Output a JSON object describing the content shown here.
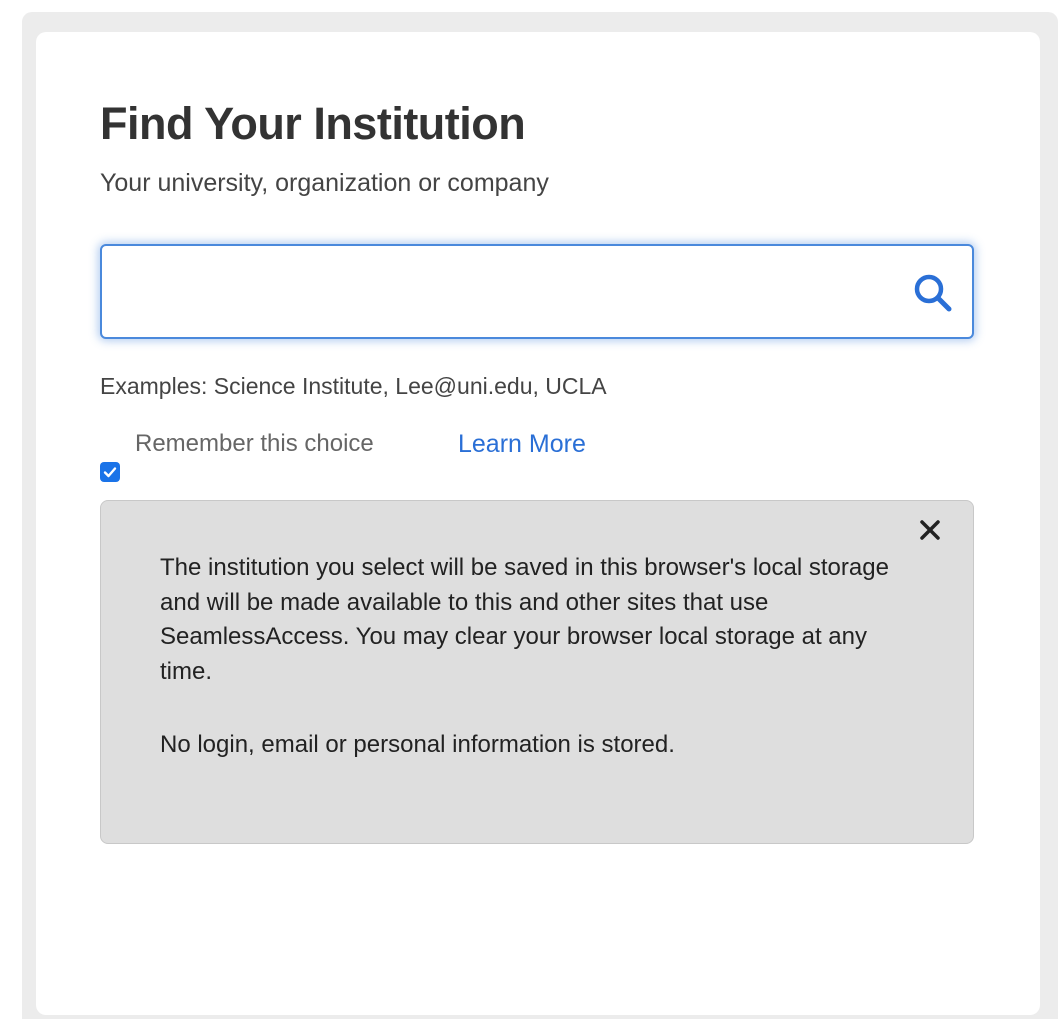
{
  "dialog": {
    "title": "Find Your Institution",
    "subtitle": "Your university, organization or company"
  },
  "search": {
    "value": "",
    "placeholder": "",
    "icon": "search-icon",
    "examples": "Examples: Science Institute, Lee@uni.edu, UCLA"
  },
  "remember": {
    "label": "Remember this choice",
    "checked": true,
    "learn_more": "Learn More"
  },
  "info_panel": {
    "close_icon": "close-icon",
    "text": "The institution you select will be saved in this browser's local storage and will be made available to this and other sites that use SeamlessAccess. You may clear your browser local storage at any time.",
    "note": "No login, email or personal information is stored."
  },
  "colors": {
    "accent": "#4a89dc",
    "link": "#2a6fd6",
    "checkbox": "#1a73e8",
    "panel_background": "#dedede"
  }
}
